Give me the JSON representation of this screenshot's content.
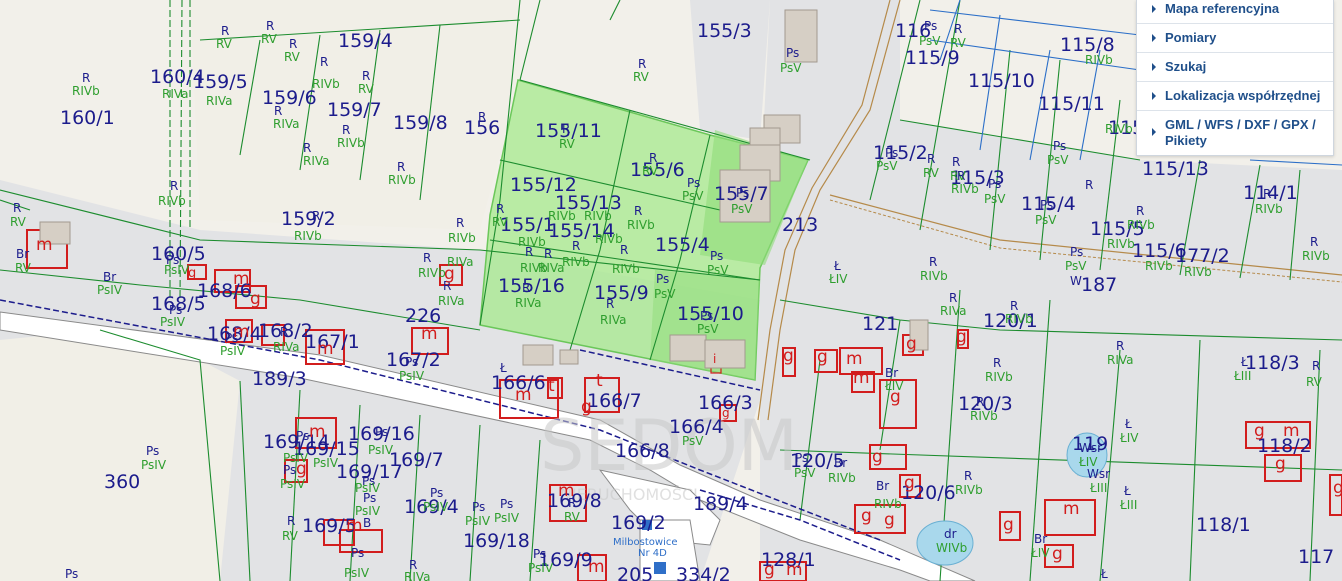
{
  "menu": {
    "items": [
      {
        "label": "Mapa referencyjna"
      },
      {
        "label": "Pomiary"
      },
      {
        "label": "Szukaj"
      },
      {
        "label": "Lokalizacja współrzędnej"
      },
      {
        "label": "GML / WFS / DXF / GPX / Pikiety"
      }
    ]
  },
  "map": {
    "watermark": "SEDOM",
    "watermark_sub": "NIERUCHOMOŚCI",
    "address_point": "Milbostowice",
    "address_number": "Nr 4D",
    "parcels": [
      "155/3",
      "159/4",
      "160/4",
      "159/5",
      "160/1",
      "159/6",
      "159/7",
      "159/8",
      "156",
      "155/11",
      "155/6",
      "155/12",
      "155/13",
      "155/1",
      "155/14",
      "155/7",
      "155/4",
      "159/2",
      "160/5",
      "155/16",
      "155/9",
      "155/10",
      "168/6",
      "168/5",
      "168/4",
      "168/2",
      "167/1",
      "226",
      "167/2",
      "189/3",
      "166/6",
      "166/7",
      "166/3",
      "166/4",
      "166/8",
      "169/14",
      "169/15",
      "169/16",
      "169/17",
      "169/7",
      "169/4",
      "169/8",
      "169/2",
      "189/4",
      "169/18",
      "169/5",
      "169/9",
      "205",
      "334/2",
      "128/1",
      "360",
      "213",
      "121",
      "120/1",
      "120/3",
      "120/5",
      "120/6",
      "119",
      "118/3",
      "118/2",
      "118/1",
      "117",
      "116",
      "115/9",
      "115/8",
      "115/10",
      "115/11",
      "115",
      "115/2",
      "115/3",
      "115/4",
      "115/13",
      "114/1",
      "115/5",
      "115/6",
      "177/2",
      "187"
    ],
    "land_classes": [
      "R",
      "RV",
      "RIVb",
      "RIVa",
      "Ps",
      "PsV",
      "PsIV",
      "Br",
      "Ł",
      "ŁIV",
      "ŁIII",
      "B",
      "W",
      "WIVb",
      "dr",
      "Wsr"
    ],
    "building_codes": [
      "m",
      "g",
      "i",
      "t"
    ]
  },
  "colors": {
    "parcel_number": "#1c1c8c",
    "land_class": "#2e9e2e",
    "building": "#d21d1d",
    "highlight": "#a6ea8c",
    "menu_text": "#1f4f8a"
  }
}
